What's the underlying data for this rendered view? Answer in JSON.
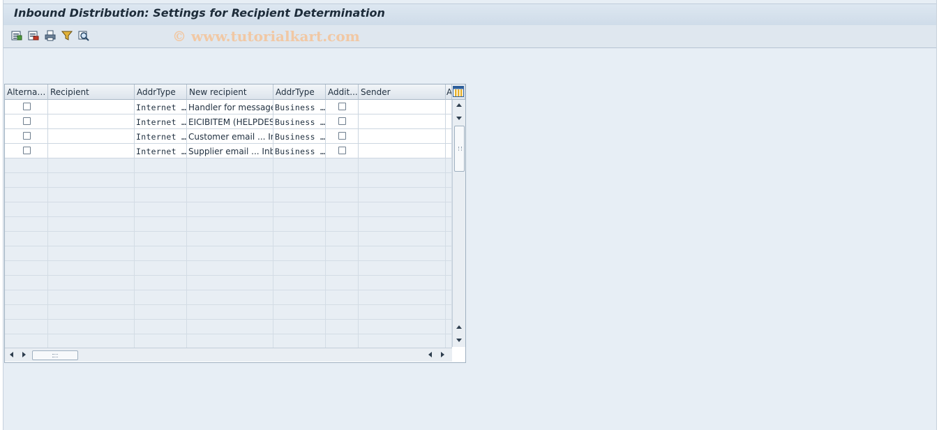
{
  "window": {
    "title": "Inbound Distribution: Settings for Recipient Determination"
  },
  "toolbar": {
    "watermark": "© www.tutorialkart.com",
    "buttons": [
      {
        "name": "details-icon"
      },
      {
        "name": "delete-icon"
      },
      {
        "name": "print-icon"
      },
      {
        "name": "filter-icon"
      },
      {
        "name": "find-icon"
      }
    ]
  },
  "table": {
    "columns": [
      {
        "label": "Alternat..."
      },
      {
        "label": "Recipient"
      },
      {
        "label": "AddrType"
      },
      {
        "label": "New recipient"
      },
      {
        "label": "AddrType"
      },
      {
        "label": "Addit..."
      },
      {
        "label": "Sender"
      },
      {
        "label": "A"
      }
    ],
    "rows": [
      {
        "alternative": false,
        "recipient": "",
        "addr_type": "Internet …",
        "new_recipient": "Handler for messages…",
        "new_addr_type": "Business …",
        "additional": false,
        "sender": ""
      },
      {
        "alternative": false,
        "recipient": "",
        "addr_type": "Internet …",
        "new_recipient": "EICIBITEM (HELPDES…",
        "new_addr_type": "Business …",
        "additional": false,
        "sender": ""
      },
      {
        "alternative": false,
        "recipient": "",
        "addr_type": "Internet …",
        "new_recipient": "Customer email ... In…",
        "new_addr_type": "Business …",
        "additional": false,
        "sender": ""
      },
      {
        "alternative": false,
        "recipient": "",
        "addr_type": "Internet …",
        "new_recipient": "Supplier email ... Inb…",
        "new_addr_type": "Business …",
        "additional": false,
        "sender": ""
      }
    ],
    "empty_row_count": 13
  },
  "colors": {
    "background": "#e7eef5",
    "title_text": "#1d2c3a",
    "watermark": "#f1c8a4",
    "grid_border": "#9fb0c0"
  }
}
